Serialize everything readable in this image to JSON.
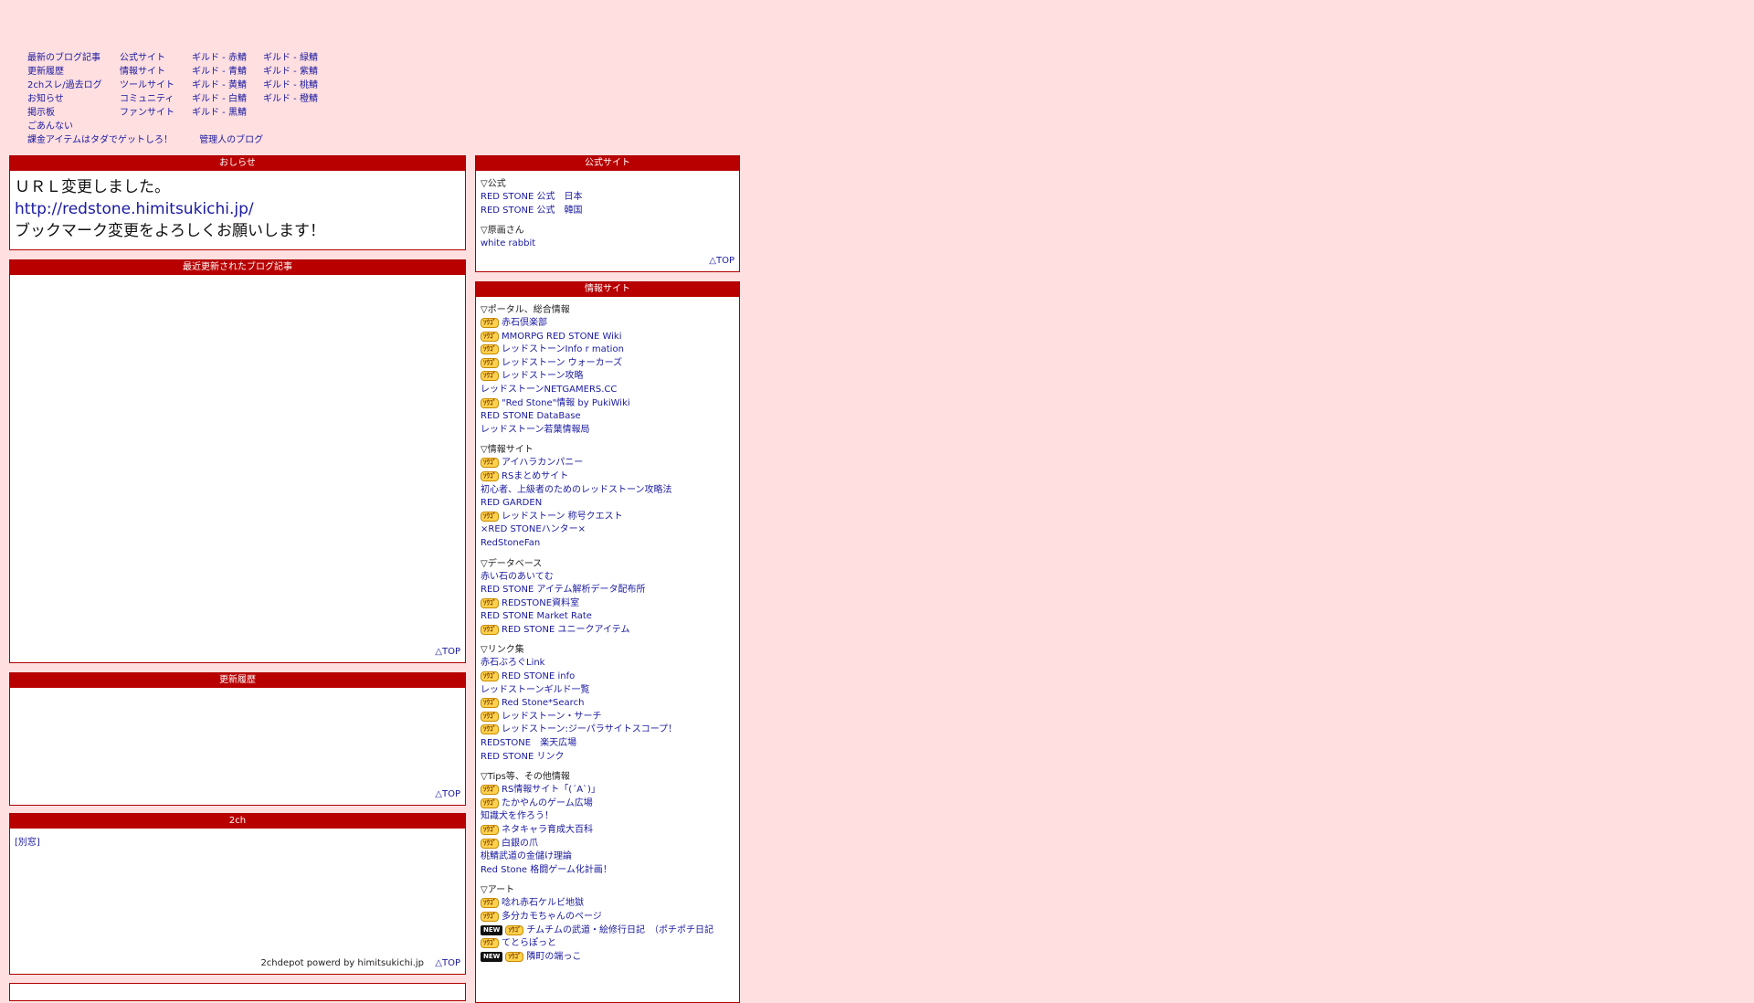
{
  "nav": {
    "col1": [
      "最新のブログ記事",
      "更新履歴",
      "2chスレ/過去ログ",
      "お知らせ",
      "掲示板",
      "ごあんない"
    ],
    "col2": [
      "公式サイト",
      "情報サイト",
      "ツールサイト",
      "コミュニティ",
      "ファンサイト"
    ],
    "col3": [
      "ギルド - 赤鯖",
      "ギルド - 青鯖",
      "ギルド - 黄鯖",
      "ギルド - 白鯖",
      "ギルド - 黒鯖"
    ],
    "col4": [
      "ギルド - 緑鯖",
      "ギルド - 紫鯖",
      "ギルド - 桃鯖",
      "ギルド - 橙鯖"
    ],
    "bottom": [
      "課金アイテムはタダでゲットしろ！",
      "管理人のブログ"
    ]
  },
  "notice": {
    "title": "おしらせ",
    "line1": "ＵＲＬ変更しました。",
    "url": "http://redstone.himitsukichi.jp/",
    "line3": "ブックマーク変更をよろしくお願いします！"
  },
  "blog": {
    "title": "最近更新されたブログ記事",
    "top": "△TOP"
  },
  "history": {
    "title": "更新履歴",
    "top": "△TOP"
  },
  "twoch": {
    "title": "2ch",
    "link": "[別窓]",
    "credit": "2chdepot powerd by himitsukichi.jp",
    "top": "△TOP"
  },
  "official": {
    "title": "公式サイト",
    "top": "△TOP",
    "sections": [
      {
        "title": "▽公式",
        "items": [
          {
            "text": "RED STONE 公式　日本"
          },
          {
            "text": "RED STONE 公式　韓国"
          }
        ]
      },
      {
        "title": "▽原画さん",
        "items": [
          {
            "text": "white rabbit"
          }
        ]
      }
    ]
  },
  "info": {
    "title": "情報サイト",
    "badge_label": "ｿｳｺﾞ",
    "new_label": "NEW",
    "sections": [
      {
        "title": "▽ポータル、総合情報",
        "items": [
          {
            "text": "赤石倶楽部",
            "badge": true
          },
          {
            "text": "MMORPG RED STONE Wiki",
            "badge": true
          },
          {
            "text": "レッドストーンInfo r mation",
            "badge": true
          },
          {
            "text": "レッドストーン ウォーカーズ",
            "badge": true
          },
          {
            "text": "レッドストーン攻略",
            "badge": true
          },
          {
            "text": "レッドストーンNETGAMERS.CC"
          },
          {
            "text": "\"Red Stone\"情報 by PukiWiki",
            "badge": true
          },
          {
            "text": "RED STONE DataBase"
          },
          {
            "text": "レッドストーン若葉情報局"
          }
        ]
      },
      {
        "title": "▽情報サイト",
        "items": [
          {
            "text": "アイハラカンパニー",
            "badge": true
          },
          {
            "text": "RSまとめサイト",
            "badge": true
          },
          {
            "text": "初心者、上級者のためのレッドストーン攻略法"
          },
          {
            "text": "RED GARDEN"
          },
          {
            "text": "レッドストーン 称号クエスト",
            "badge": true
          },
          {
            "text": "×RED STONEハンター×"
          },
          {
            "text": "RedStoneFan"
          }
        ]
      },
      {
        "title": "▽データベース",
        "items": [
          {
            "text": "赤い石のあいてむ"
          },
          {
            "text": "RED STONE アイテム解析データ配布所"
          },
          {
            "text": "REDSTONE資料室",
            "badge": true
          },
          {
            "text": "RED STONE Market Rate"
          },
          {
            "text": "RED STONE ユニークアイテム",
            "badge": true
          }
        ]
      },
      {
        "title": "▽リンク集",
        "items": [
          {
            "text": "赤石ぶろぐLink"
          },
          {
            "text": "RED STONE info",
            "badge": true
          },
          {
            "text": "レッドストーンギルド一覧"
          },
          {
            "text": "Red Stone*Search",
            "badge": true
          },
          {
            "text": "レッドストーン・サーチ",
            "badge": true
          },
          {
            "text": "レッドストーン:ジーパラサイトスコープ！",
            "badge": true
          },
          {
            "text": "REDSTONE　楽天広場"
          },
          {
            "text": "RED STONE リンク"
          }
        ]
      },
      {
        "title": "▽Tips等、その他情報",
        "items": [
          {
            "text": "RS情報サイト「(´A`)」",
            "badge": true
          },
          {
            "text": "たかやんのゲーム広場",
            "badge": true
          },
          {
            "text": "知識犬を作ろう！"
          },
          {
            "text": "ネタキャラ育成大百科",
            "badge": true
          },
          {
            "text": "白銀の爪",
            "badge": true
          },
          {
            "text": "桃鯖武道の金儲け理論"
          },
          {
            "text": "Red Stone 格闘ゲーム化計画！"
          }
        ]
      },
      {
        "title": "▽アート",
        "items": [
          {
            "text": "唸れ赤石ケルビ地獄",
            "badge": true
          },
          {
            "text": "多分カモちゃんのページ",
            "badge": true
          },
          {
            "text": "チムチムの武道・絵修行日記　（ポチポチ日記",
            "badge": true,
            "new": true
          },
          {
            "text": "てとらぽっと",
            "badge": true
          },
          {
            "text": "隣町の端っこ",
            "badge": true,
            "new": true
          }
        ]
      }
    ]
  }
}
